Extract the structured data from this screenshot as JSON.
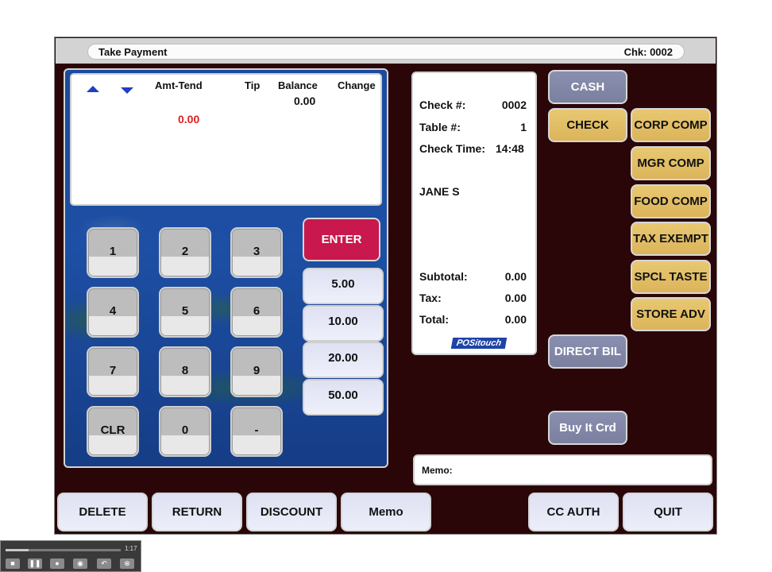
{
  "header": {
    "title": "Take Payment",
    "check_label": "Chk:",
    "check_number": "0002"
  },
  "tender_display": {
    "columns": [
      "Amt-Tend",
      "Tip",
      "Balance",
      "Change"
    ],
    "balance_value": "0.00",
    "amount_tendered": "0.00",
    "amount_color": "#e02020"
  },
  "keypad": {
    "keys": [
      "1",
      "2",
      "3",
      "4",
      "5",
      "6",
      "7",
      "8",
      "9",
      "CLR",
      "0",
      "-"
    ],
    "enter_label": "ENTER",
    "quick_amounts": [
      "5.00",
      "10.00",
      "20.00",
      "50.00"
    ]
  },
  "check": {
    "check_label": "Check #:",
    "check_value": "0002",
    "table_label": "Table #:",
    "table_value": "1",
    "time_label": "Check Time:",
    "time_value": "14:48",
    "server": "JANE S",
    "subtotal_label": "Subtotal:",
    "subtotal_value": "0.00",
    "tax_label": "Tax:",
    "tax_value": "0.00",
    "total_label": "Total:",
    "total_value": "0.00",
    "logo_text": "POSitouch"
  },
  "payment_buttons": {
    "cash": "CASH",
    "check": "CHECK",
    "corp_comp": "CORP COMP",
    "mgr_comp": "MGR COMP",
    "food_comp": "FOOD COMP",
    "tax_exempt": "TAX EXEMPT",
    "spcl_taste": "SPCL TASTE",
    "store_adv": "STORE ADV",
    "direct_bil": "DIRECT BIL",
    "buy_it_crd": "Buy It Crd"
  },
  "memo": {
    "label": "Memo:"
  },
  "bottom_bar": {
    "delete": "DELETE",
    "return": "RETURN",
    "discount": "DISCOUNT",
    "memo": "Memo",
    "cc_auth": "CC AUTH",
    "quit": "QUIT"
  },
  "player": {
    "time": "1:17",
    "progress": 0.2
  }
}
